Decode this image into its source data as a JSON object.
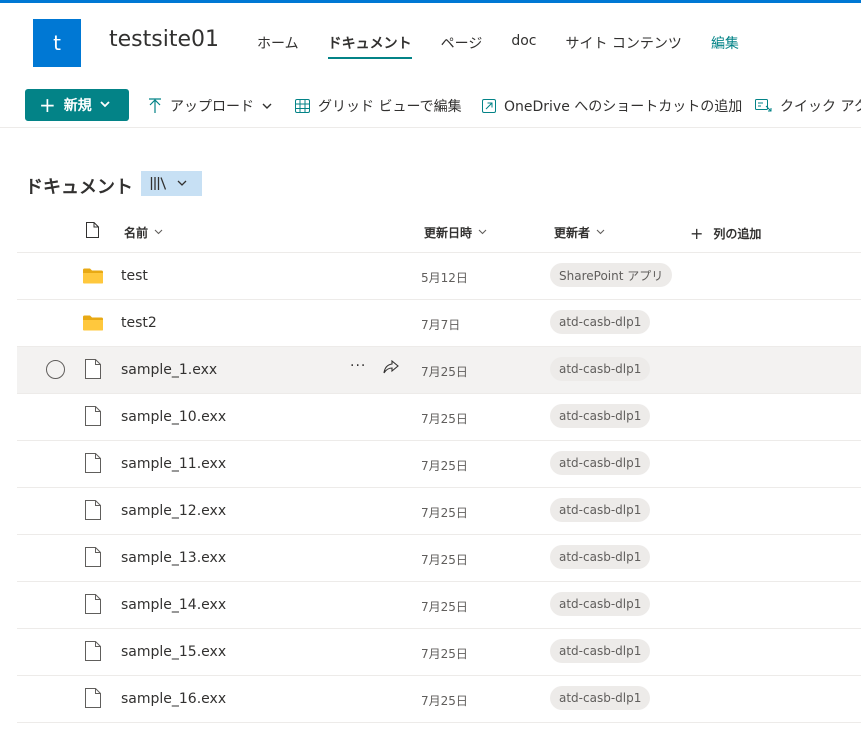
{
  "site": {
    "logo_letter": "t",
    "title": "testsite01",
    "nav": [
      {
        "label": "ホーム"
      },
      {
        "label": "ドキュメント"
      },
      {
        "label": "ページ"
      },
      {
        "label": "doc"
      },
      {
        "label": "サイト コンテンツ"
      },
      {
        "label": "編集"
      }
    ]
  },
  "commandbar": {
    "new_label": "新規",
    "upload_label": "アップロード",
    "grid_edit_label": "グリッド ビューで編集",
    "onedrive_label": "OneDrive へのショートカットの追加",
    "quick_label": "クイック アク"
  },
  "library": {
    "title": "ドキュメント",
    "columns": {
      "name": "名前",
      "modified": "更新日時",
      "modified_by": "更新者",
      "add_column": "列の追加"
    },
    "rows": [
      {
        "type": "folder",
        "name": "test",
        "modified": "5月12日",
        "modified_by": "SharePoint アプリ"
      },
      {
        "type": "folder",
        "name": "test2",
        "modified": "7月7日",
        "modified_by": "atd-casb-dlp1"
      },
      {
        "type": "file",
        "name": "sample_1.exx",
        "modified": "7月25日",
        "modified_by": "atd-casb-dlp1",
        "more": "···"
      },
      {
        "type": "file",
        "name": "sample_10.exx",
        "modified": "7月25日",
        "modified_by": "atd-casb-dlp1"
      },
      {
        "type": "file",
        "name": "sample_11.exx",
        "modified": "7月25日",
        "modified_by": "atd-casb-dlp1"
      },
      {
        "type": "file",
        "name": "sample_12.exx",
        "modified": "7月25日",
        "modified_by": "atd-casb-dlp1"
      },
      {
        "type": "file",
        "name": "sample_13.exx",
        "modified": "7月25日",
        "modified_by": "atd-casb-dlp1"
      },
      {
        "type": "file",
        "name": "sample_14.exx",
        "modified": "7月25日",
        "modified_by": "atd-casb-dlp1"
      },
      {
        "type": "file",
        "name": "sample_15.exx",
        "modified": "7月25日",
        "modified_by": "atd-casb-dlp1"
      },
      {
        "type": "file",
        "name": "sample_16.exx",
        "modified": "7月25日",
        "modified_by": "atd-casb-dlp1"
      }
    ]
  },
  "colors": {
    "accent": "#038387",
    "brand": "#0078d4"
  }
}
